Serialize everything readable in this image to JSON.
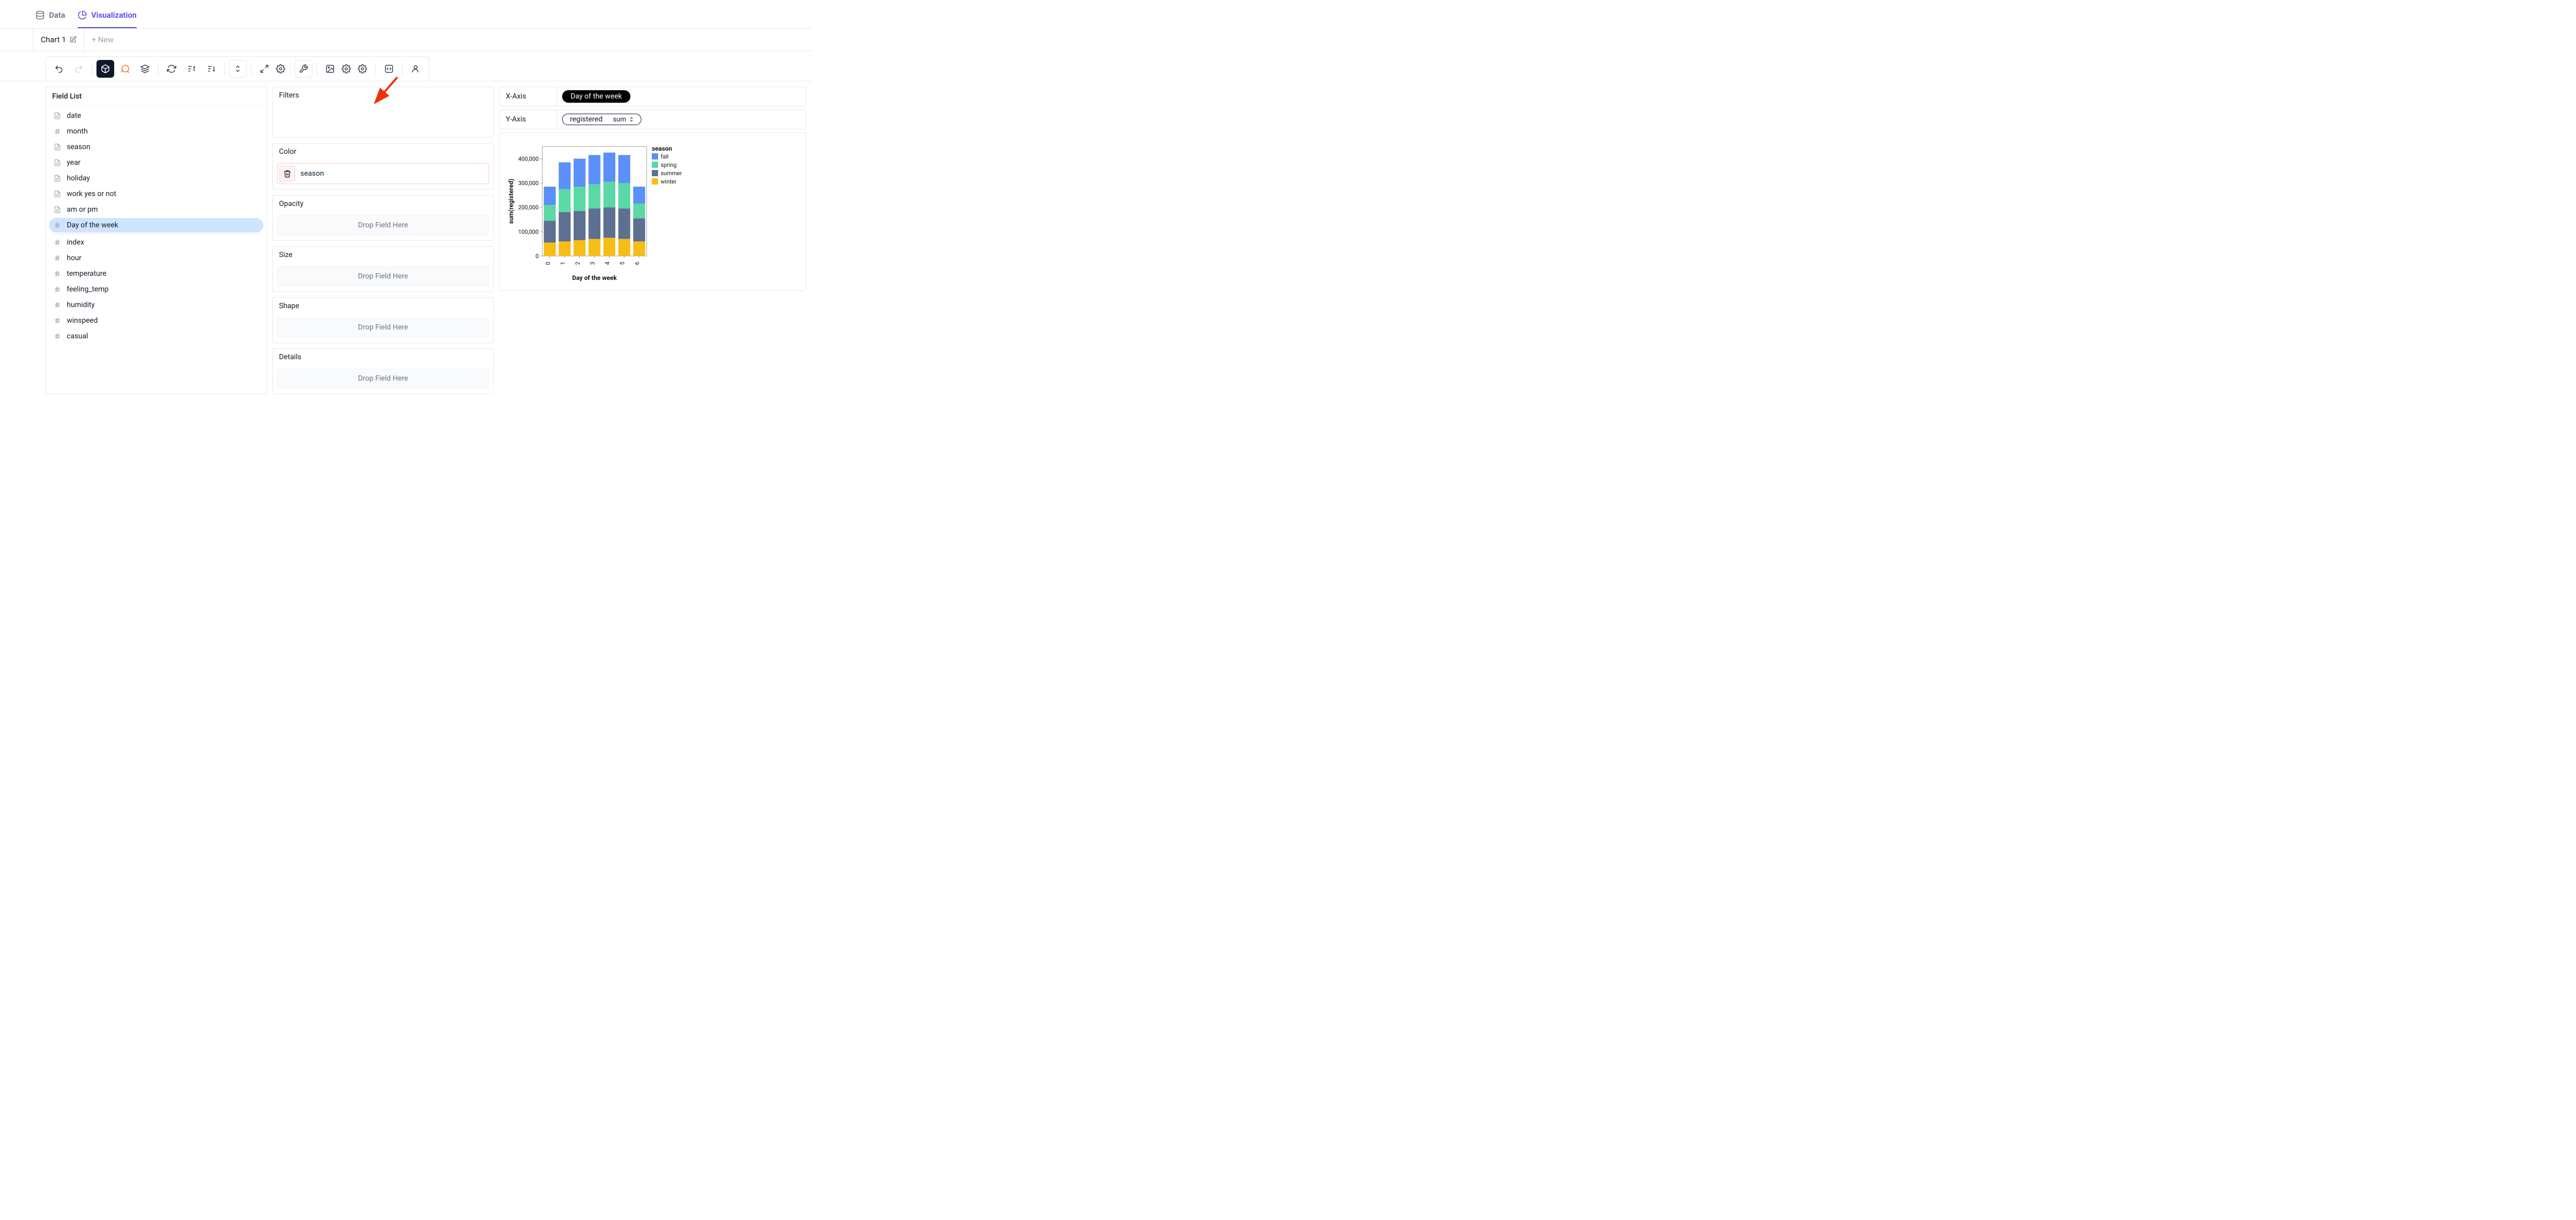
{
  "top_tabs": {
    "data": "Data",
    "viz": "Visualization"
  },
  "tabs": {
    "chart1": "Chart 1",
    "new": "+ New"
  },
  "field_list": {
    "title": "Field List",
    "items": [
      {
        "label": "date",
        "type": "text",
        "sel": false
      },
      {
        "label": "month",
        "type": "num",
        "sel": false
      },
      {
        "label": "season",
        "type": "text",
        "sel": false
      },
      {
        "label": "year",
        "type": "text",
        "sel": false
      },
      {
        "label": "holiday",
        "type": "text",
        "sel": false
      },
      {
        "label": "work yes or not",
        "type": "text",
        "sel": false
      },
      {
        "label": "am or pm",
        "type": "text",
        "sel": false
      },
      {
        "label": "Day of the week",
        "type": "num",
        "sel": true,
        "hr": true
      },
      {
        "label": "index",
        "type": "num",
        "sel": false
      },
      {
        "label": "hour",
        "type": "num",
        "sel": false
      },
      {
        "label": "temperature",
        "type": "num",
        "sel": false
      },
      {
        "label": "feeling_temp",
        "type": "num",
        "sel": false
      },
      {
        "label": "humidity",
        "type": "num",
        "sel": false
      },
      {
        "label": "winspeed",
        "type": "num",
        "sel": false
      },
      {
        "label": "casual",
        "type": "num",
        "sel": false
      }
    ]
  },
  "encodings": {
    "filters": "Filters",
    "color": "Color",
    "color_field": "season",
    "opacity": "Opacity",
    "size": "Size",
    "shape": "Shape",
    "details": "Details",
    "drop": "Drop Field Here"
  },
  "axes": {
    "x_label": "X-Axis",
    "x_value": "Day of the week",
    "y_label": "Y-Axis",
    "y_value": "registered",
    "y_agg": "sum"
  },
  "chart_data": {
    "type": "bar",
    "stacked": true,
    "title": "",
    "xlabel": "Day of the week",
    "ylabel": "sum(registered)",
    "ylim": [
      0,
      450000
    ],
    "yticks": [
      0,
      100000,
      200000,
      300000,
      400000
    ],
    "ytick_labels": [
      "0",
      "100,000",
      "200,000",
      "300,000",
      "400,000"
    ],
    "categories": [
      "0",
      "1",
      "2",
      "3",
      "4",
      "5",
      "6"
    ],
    "legend_title": "season",
    "series": [
      {
        "name": "fall",
        "color": "#5b8ff9",
        "values": [
          75000,
          110000,
          115000,
          120000,
          120000,
          115000,
          70000
        ]
      },
      {
        "name": "spring",
        "color": "#5ad8a6",
        "values": [
          65000,
          95000,
          100000,
          100000,
          105000,
          105000,
          60000
        ]
      },
      {
        "name": "summer",
        "color": "#5d7092",
        "values": [
          90000,
          120000,
          120000,
          125000,
          125000,
          125000,
          95000
        ]
      },
      {
        "name": "winter",
        "color": "#f6bd16",
        "values": [
          55000,
          60000,
          65000,
          70000,
          75000,
          70000,
          60000
        ]
      }
    ]
  }
}
